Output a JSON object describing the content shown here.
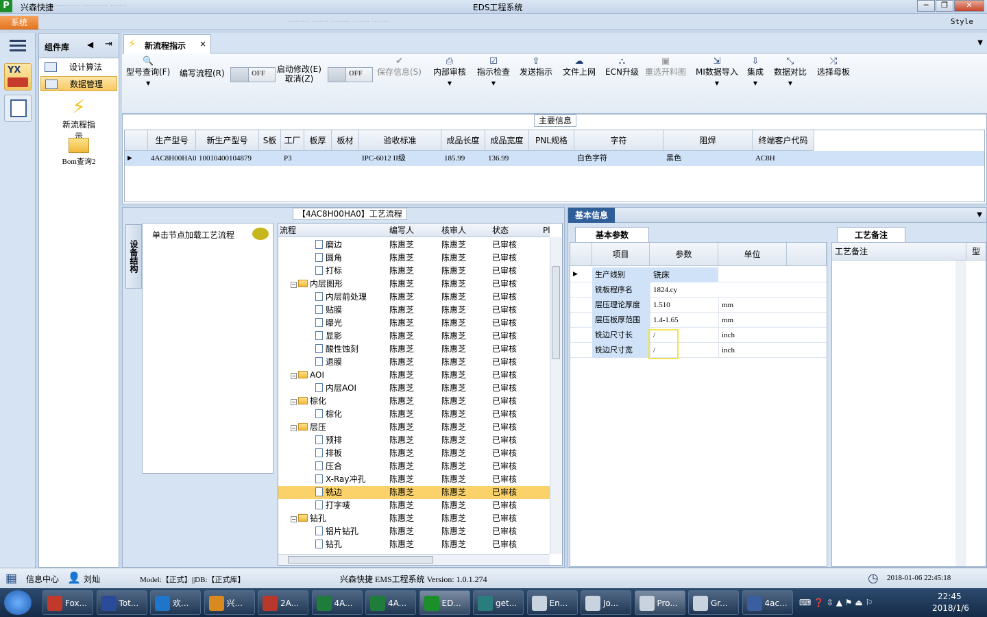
{
  "window": {
    "app_name": "兴森快捷",
    "title": "EDS工程系统",
    "minimize": "─",
    "maximize": "❐",
    "close": "✕"
  },
  "menu": {
    "system_tab": "系统",
    "style_label": "Style"
  },
  "component_panel": {
    "title": "组件库",
    "items": [
      {
        "label": "设计算法"
      },
      {
        "label": "数据管理"
      }
    ],
    "big_items": [
      {
        "label": "新流程指示"
      },
      {
        "label": "Bom查询2"
      }
    ]
  },
  "doc_tab": {
    "label": "新流程指示",
    "close": "×"
  },
  "toolbar": {
    "query": "型号查询(F)",
    "write_flow": "编写流程(R)",
    "off1": "OFF",
    "start_modify_line1": "启动修改(E)",
    "start_modify_line2": "取消(Z)",
    "off2": "OFF",
    "save": "保存信息(S)",
    "internal_review": "内部审核",
    "instr_check": "指示检查",
    "send_instr": "发送指示",
    "upload": "文件上网",
    "ecn": "ECN升级",
    "rechoose": "重选开料图",
    "mi_import": "MI数据导入",
    "integrate": "集成",
    "compare": "数据对比",
    "select_board": "选择母板"
  },
  "main_info": {
    "title": "主要信息",
    "columns": [
      "生产型号",
      "新生产型号",
      "S板",
      "工厂",
      "板厚",
      "板材",
      "验收标准",
      "成品长度",
      "成品宽度",
      "PNL规格",
      "字符",
      "阻焊",
      "终端客户代码"
    ],
    "row": [
      "4AC8H00HA0",
      "10010400104879",
      "",
      "P3",
      "",
      "",
      "IPC-6012 II级",
      "185.99",
      "136.99",
      "",
      "白色字符",
      "黑色",
      "AC8H"
    ]
  },
  "flow_panel": {
    "title": "【4AC8H00HA0】工艺流程",
    "vtab": "设备结构",
    "node_hint": "单击节点加载工艺流程",
    "columns": [
      "流程",
      "编写人",
      "核审人",
      "状态",
      "Pl"
    ],
    "rows": [
      {
        "name": "磨边",
        "level": 2,
        "folder": false,
        "writer": "陈惠芝",
        "reviewer": "陈惠芝",
        "status": "已审核"
      },
      {
        "name": "圆角",
        "level": 2,
        "folder": false,
        "writer": "陈惠芝",
        "reviewer": "陈惠芝",
        "status": "已审核"
      },
      {
        "name": "打标",
        "level": 2,
        "folder": false,
        "writer": "陈惠芝",
        "reviewer": "陈惠芝",
        "status": "已审核"
      },
      {
        "name": "内层图形",
        "level": 1,
        "folder": true,
        "writer": "陈惠芝",
        "reviewer": "陈惠芝",
        "status": "已审核"
      },
      {
        "name": "内层前处理",
        "level": 2,
        "folder": false,
        "writer": "陈惠芝",
        "reviewer": "陈惠芝",
        "status": "已审核"
      },
      {
        "name": "贴膜",
        "level": 2,
        "folder": false,
        "writer": "陈惠芝",
        "reviewer": "陈惠芝",
        "status": "已审核"
      },
      {
        "name": "曝光",
        "level": 2,
        "folder": false,
        "writer": "陈惠芝",
        "reviewer": "陈惠芝",
        "status": "已审核"
      },
      {
        "name": "显影",
        "level": 2,
        "folder": false,
        "writer": "陈惠芝",
        "reviewer": "陈惠芝",
        "status": "已审核"
      },
      {
        "name": "酸性蚀刻",
        "level": 2,
        "folder": false,
        "writer": "陈惠芝",
        "reviewer": "陈惠芝",
        "status": "已审核"
      },
      {
        "name": "退膜",
        "level": 2,
        "folder": false,
        "writer": "陈惠芝",
        "reviewer": "陈惠芝",
        "status": "已审核"
      },
      {
        "name": "AOI",
        "level": 1,
        "folder": true,
        "writer": "陈惠芝",
        "reviewer": "陈惠芝",
        "status": "已审核"
      },
      {
        "name": "内层AOI",
        "level": 2,
        "folder": false,
        "writer": "陈惠芝",
        "reviewer": "陈惠芝",
        "status": "已审核"
      },
      {
        "name": "棕化",
        "level": 1,
        "folder": true,
        "writer": "陈惠芝",
        "reviewer": "陈惠芝",
        "status": "已审核"
      },
      {
        "name": "棕化",
        "level": 2,
        "folder": false,
        "writer": "陈惠芝",
        "reviewer": "陈惠芝",
        "status": "已审核"
      },
      {
        "name": "层压",
        "level": 1,
        "folder": true,
        "writer": "陈惠芝",
        "reviewer": "陈惠芝",
        "status": "已审核"
      },
      {
        "name": "预排",
        "level": 2,
        "folder": false,
        "writer": "陈惠芝",
        "reviewer": "陈惠芝",
        "status": "已审核"
      },
      {
        "name": "排板",
        "level": 2,
        "folder": false,
        "writer": "陈惠芝",
        "reviewer": "陈惠芝",
        "status": "已审核"
      },
      {
        "name": "压合",
        "level": 2,
        "folder": false,
        "writer": "陈惠芝",
        "reviewer": "陈惠芝",
        "status": "已审核"
      },
      {
        "name": "X-Ray冲孔",
        "level": 2,
        "folder": false,
        "writer": "陈惠芝",
        "reviewer": "陈惠芝",
        "status": "已审核"
      },
      {
        "name": "铣边",
        "level": 2,
        "folder": false,
        "writer": "陈惠芝",
        "reviewer": "陈惠芝",
        "status": "已审核",
        "selected": true
      },
      {
        "name": "打字唛",
        "level": 2,
        "folder": false,
        "writer": "陈惠芝",
        "reviewer": "陈惠芝",
        "status": "已审核"
      },
      {
        "name": "钻孔",
        "level": 1,
        "folder": true,
        "writer": "陈惠芝",
        "reviewer": "陈惠芝",
        "status": "已审核"
      },
      {
        "name": "铝片钻孔",
        "level": 2,
        "folder": false,
        "writer": "陈惠芝",
        "reviewer": "陈惠芝",
        "status": "已审核"
      },
      {
        "name": "钻孔",
        "level": 2,
        "folder": false,
        "writer": "陈惠芝",
        "reviewer": "陈惠芝",
        "status": "已审核"
      }
    ]
  },
  "basic_info": {
    "title": "基本信息",
    "param_tab": "基本参数",
    "note_tab": "工艺备注",
    "columns": [
      "项目",
      "参数",
      "单位"
    ],
    "note_col": "工艺备注",
    "note_col2": "型",
    "rows": [
      {
        "item": "生产线别",
        "value": "铣床",
        "unit": ""
      },
      {
        "item": "铣板程序名",
        "value": "1824.cy",
        "unit": ""
      },
      {
        "item": "层压理论厚度",
        "value": "1.510",
        "unit": "mm"
      },
      {
        "item": "层压板厚范围",
        "value": "1.4-1.65",
        "unit": "mm"
      },
      {
        "item": "铣边尺寸长",
        "value": "/",
        "unit": "inch"
      },
      {
        "item": "铣边尺寸宽",
        "value": "/",
        "unit": "inch"
      }
    ]
  },
  "statusbar": {
    "info_center": "信息中心",
    "user": "刘灿",
    "model": "Model:【正式】||DB:【正式库】",
    "version": "兴森快捷 EMS工程系统 Version: 1.0.1.274",
    "datetime": "2018-01-06 22:45:18"
  },
  "taskbar": {
    "items": [
      "Fox...",
      "Tot...",
      "欢...",
      "兴...",
      "2A...",
      "4A...",
      "4A...",
      "ED...",
      "get...",
      "En...",
      "Jo...",
      "Pro...",
      "Gr...",
      "4ac..."
    ],
    "time": "22:45",
    "date": "2018/1/6"
  }
}
